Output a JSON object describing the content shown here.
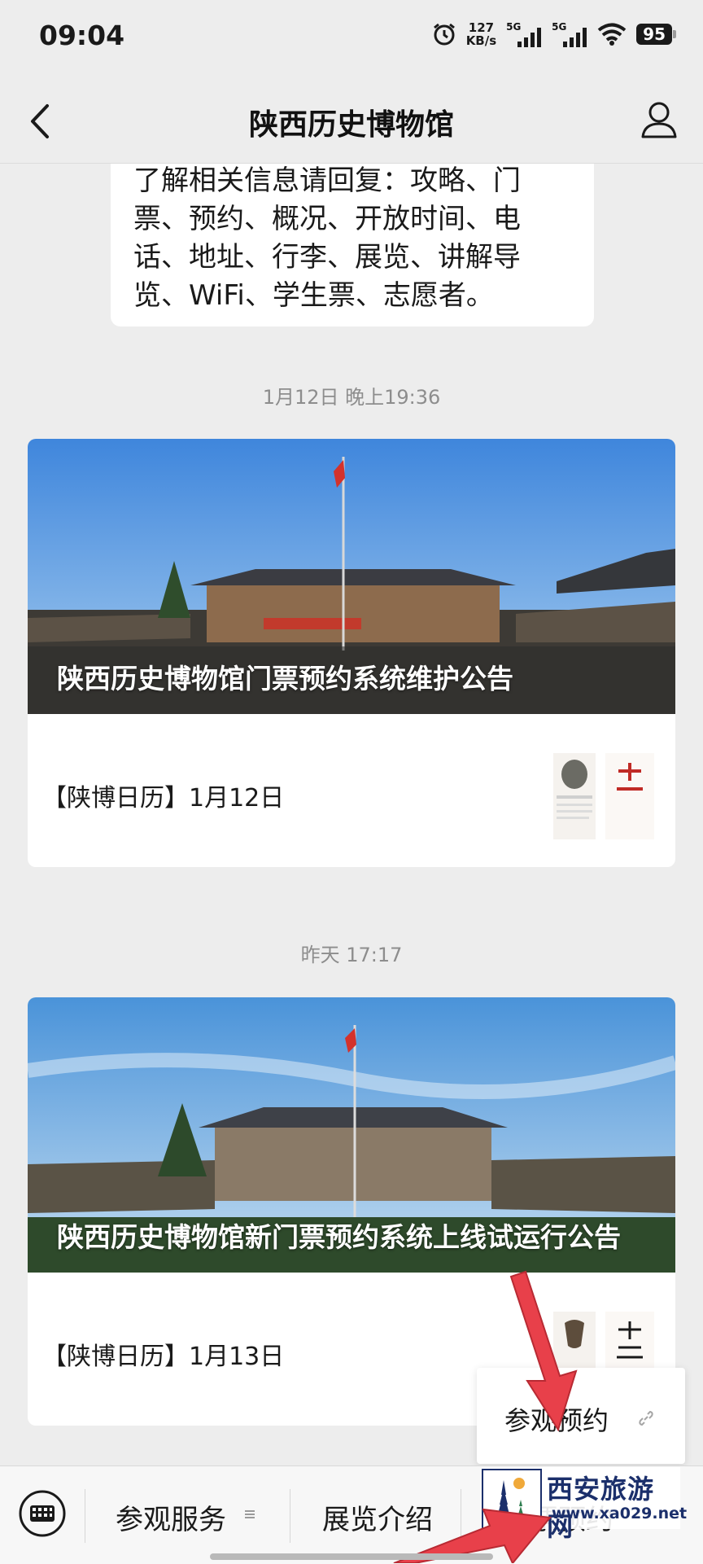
{
  "status_bar": {
    "time": "09:04",
    "net_speed_value": "127",
    "net_speed_unit": "KB/s",
    "signal1_tag": "5G",
    "signal2_tag": "5G",
    "battery": "95"
  },
  "nav": {
    "title": "陕西历史博物馆"
  },
  "chat": {
    "reply_lines": [
      "了解相关信息请回复：攻略、门",
      "票、预约、概况、开放时间、电",
      "话、地址、行李、展览、讲解导",
      "览、WiFi、学生票、志愿者。"
    ],
    "messages": [
      {
        "timestamp": "1月12日 晚上19:36",
        "cover_title": "陕西历史博物馆门票预约系统维护公告",
        "sub_title": "【陕博日历】1月12日"
      },
      {
        "timestamp": "昨天 17:17",
        "cover_title": "陕西历史博物馆新门票预约系统上线试运行公告",
        "sub_title": "【陕博日历】1月13日"
      }
    ]
  },
  "quick_menu": {
    "label": "参观预约"
  },
  "bottom_menu": {
    "items": [
      "参观服务",
      "展览介绍",
      "门票预约"
    ]
  },
  "watermark": {
    "name": "西安旅游网",
    "url": "www.xa029.net"
  },
  "colors": {
    "background": "#ededed",
    "arrow": "#e8404a",
    "watermark": "#1b2f6b"
  },
  "icons": [
    "alarm-icon",
    "signal-icon",
    "wifi-icon",
    "back-icon",
    "profile-icon",
    "link-icon",
    "keyboard-icon",
    "menu-icon"
  ]
}
